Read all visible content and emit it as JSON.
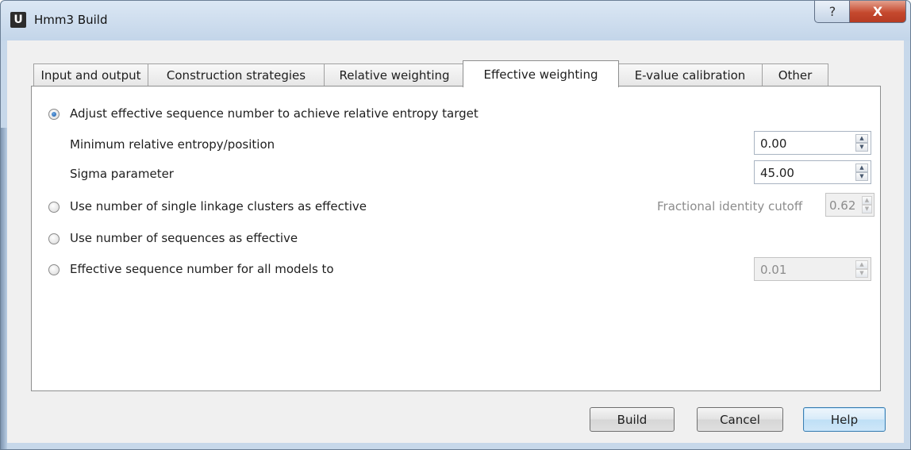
{
  "window": {
    "title": "Hmm3 Build",
    "logo_letter": "U",
    "help_glyph": "?",
    "close_glyph": "X"
  },
  "tabs": [
    {
      "label": "Input and output",
      "active": false
    },
    {
      "label": "Construction strategies",
      "active": false
    },
    {
      "label": "Relative weighting",
      "active": false
    },
    {
      "label": "Effective weighting",
      "active": true
    },
    {
      "label": "E-value calibration",
      "active": false
    },
    {
      "label": "Other",
      "active": false
    }
  ],
  "panel": {
    "option_entropy": {
      "label": "Adjust effective sequence number to achieve relative entropy target",
      "checked": true,
      "min_entropy_label": "Minimum relative entropy/position",
      "min_entropy_value": "0.00",
      "sigma_label": "Sigma parameter",
      "sigma_value": "45.00"
    },
    "option_clusters": {
      "label": "Use number of single linkage clusters as effective",
      "checked": false,
      "cutoff_label": "Fractional identity cutoff",
      "cutoff_value": "0.62"
    },
    "option_sequences": {
      "label": "Use number of sequences as effective",
      "checked": false
    },
    "option_fixed": {
      "label": "Effective sequence number for all models to",
      "checked": false,
      "value": "0.01"
    }
  },
  "buttons": {
    "build": "Build",
    "cancel": "Cancel",
    "help": "Help"
  },
  "icons": {
    "spin_up": "▲",
    "spin_down": "▼"
  }
}
